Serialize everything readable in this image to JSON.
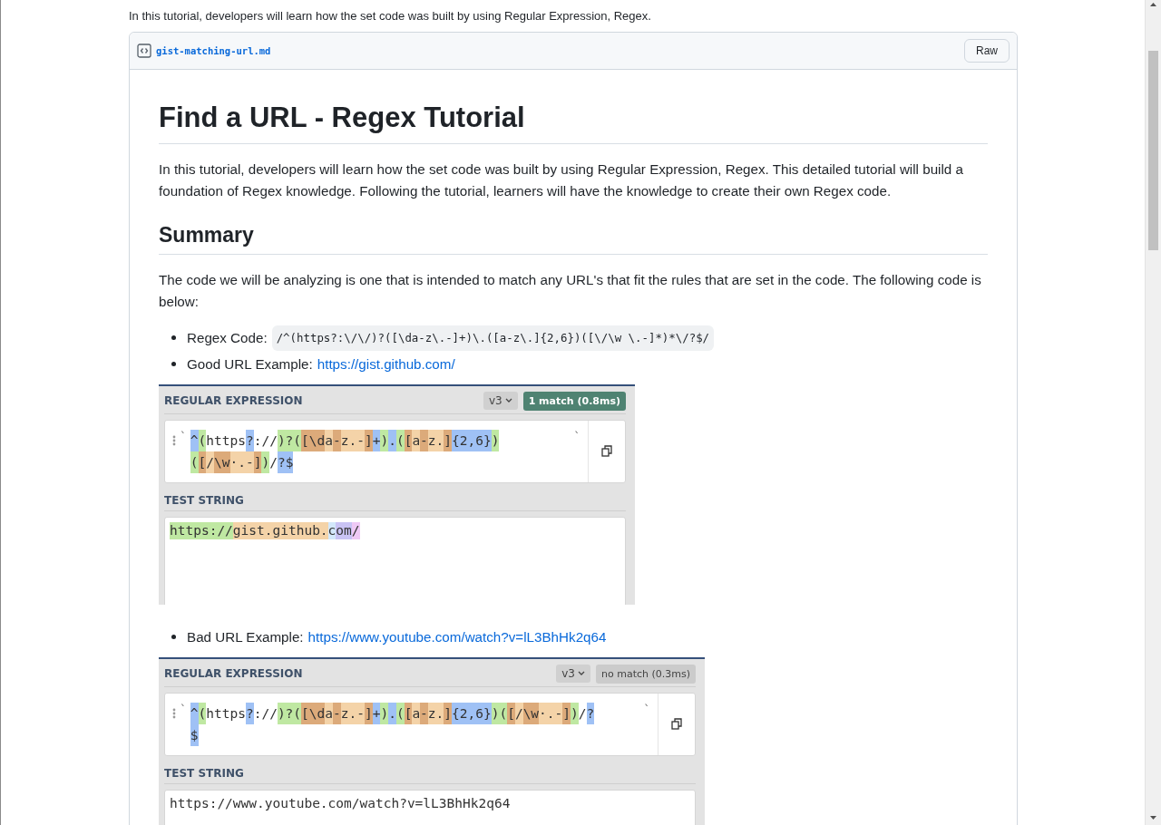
{
  "intro": "In this tutorial, developers will learn how the set code was built by using Regular Expression, Regex.",
  "gist": {
    "filename": "gist-matching-url.md",
    "raw_button": "Raw"
  },
  "article": {
    "title": "Find a URL - Regex Tutorial",
    "intro": "In this tutorial, developers will learn how the set code was built by using Regular Expression, Regex. This detailed tutorial will build a foundation of Regex knowledge. Following the tutorial, learners will have the knowledge to create their own Regex code.",
    "summary_heading": "Summary",
    "summary_text": "The code we will be analyzing is one that is intended to match any URL's that fit the rules that are set in the code. The following code is below:",
    "blocks": [
      {
        "kind": "bullet",
        "label": "Regex Code:",
        "code": "/^(https?:\\/\\/)?([\\da-z\\.-]+)\\.([a-z\\.]{2,6})([\\/\\w \\.-]*)*\\/?$/"
      },
      {
        "kind": "bullet",
        "label": "Good URL Example:",
        "link": "https://gist.github.com/"
      },
      {
        "kind": "regex_panel",
        "heading": "REGULAR EXPRESSION",
        "version": "v3",
        "result": "1 match (0.8ms)",
        "matched": true,
        "delimiter": "`",
        "test_heading": "TEST STRING",
        "lines": [
          [
            {
              "t": "^",
              "color": "#9fc1f5"
            },
            {
              "t": "(",
              "color": "#bfe8a2"
            },
            {
              "t": "https"
            },
            {
              "t": "?",
              "color": "#9fc1f5"
            },
            {
              "t": "://"
            },
            {
              "t": ")?(",
              "color": "#bfe8a2"
            },
            {
              "t": "[\\d",
              "color": "#dcaa7a"
            },
            {
              "t": "a",
              "color": "#f4d3a8"
            },
            {
              "t": "-",
              "color": "#dcaa7a"
            },
            {
              "t": "z.-",
              "color": "#f4d3a8"
            },
            {
              "t": "]",
              "color": "#dcaa7a"
            },
            {
              "t": "+",
              "color": "#9fc1f5"
            },
            {
              "t": ")",
              "color": "#bfe8a2"
            },
            {
              "t": ".",
              "color": "#9fc1f5"
            },
            {
              "t": "(",
              "color": "#bfe8a2"
            },
            {
              "t": "[",
              "color": "#dcaa7a"
            },
            {
              "t": "a",
              "color": "#f4d3a8"
            },
            {
              "t": "-",
              "color": "#dcaa7a"
            },
            {
              "t": "z.",
              "color": "#f4d3a8"
            },
            {
              "t": "]",
              "color": "#dcaa7a"
            },
            {
              "t": "{2,6}",
              "color": "#9fc1f5"
            },
            {
              "t": ")",
              "color": "#bfe8a2"
            }
          ],
          [
            {
              "t": "(",
              "color": "#bfe8a2"
            },
            {
              "t": "[",
              "color": "#dcaa7a"
            },
            {
              "t": "/",
              "color": "#f4d3a8"
            },
            {
              "t": "\\w",
              "color": "#dcaa7a"
            },
            {
              "t": "·.-",
              "color": "#f4d3a8"
            },
            {
              "t": "]",
              "color": "#dcaa7a"
            },
            {
              "t": ")",
              "color": "#bfe8a2"
            },
            {
              "t": "/"
            },
            {
              "t": "?$",
              "color": "#9fc1f5"
            }
          ]
        ],
        "test": [
          {
            "t": "https://",
            "color": "#bfe8a2"
          },
          {
            "t": "gist.github.",
            "color": "#f4d3a8"
          },
          {
            "t": "c",
            "color": "#d3e8fb"
          },
          {
            "t": "om",
            "color": "#c9c3f4"
          },
          {
            "t": "/",
            "color": "#efc9f5"
          }
        ]
      },
      {
        "kind": "bullet",
        "label": "Bad URL Example:",
        "link": "https://www.youtube.com/watch?v=lL3BhHk2q64"
      },
      {
        "kind": "regex_panel",
        "heading": "REGULAR EXPRESSION",
        "version": "v3",
        "result": "no match (0.3ms)",
        "matched": false,
        "delimiter": "`",
        "test_heading": "TEST STRING",
        "lines": [
          [
            {
              "t": "^",
              "color": "#9fc1f5"
            },
            {
              "t": "(",
              "color": "#bfe8a2"
            },
            {
              "t": "https"
            },
            {
              "t": "?",
              "color": "#9fc1f5"
            },
            {
              "t": "://"
            },
            {
              "t": ")?(",
              "color": "#bfe8a2"
            },
            {
              "t": "[\\d",
              "color": "#dcaa7a"
            },
            {
              "t": "a",
              "color": "#f4d3a8"
            },
            {
              "t": "-",
              "color": "#dcaa7a"
            },
            {
              "t": "z.-",
              "color": "#f4d3a8"
            },
            {
              "t": "]",
              "color": "#dcaa7a"
            },
            {
              "t": "+",
              "color": "#9fc1f5"
            },
            {
              "t": ")",
              "color": "#bfe8a2"
            },
            {
              "t": ".",
              "color": "#9fc1f5"
            },
            {
              "t": "(",
              "color": "#bfe8a2"
            },
            {
              "t": "[",
              "color": "#dcaa7a"
            },
            {
              "t": "a",
              "color": "#f4d3a8"
            },
            {
              "t": "-",
              "color": "#dcaa7a"
            },
            {
              "t": "z.",
              "color": "#f4d3a8"
            },
            {
              "t": "]",
              "color": "#dcaa7a"
            },
            {
              "t": "{2,6}",
              "color": "#9fc1f5"
            },
            {
              "t": ")(",
              "color": "#bfe8a2"
            },
            {
              "t": "[",
              "color": "#dcaa7a"
            },
            {
              "t": "/",
              "color": "#f4d3a8"
            },
            {
              "t": "\\w",
              "color": "#dcaa7a"
            },
            {
              "t": "·.-",
              "color": "#f4d3a8"
            },
            {
              "t": "]",
              "color": "#dcaa7a"
            },
            {
              "t": ")",
              "color": "#bfe8a2"
            },
            {
              "t": "/"
            },
            {
              "t": "?",
              "color": "#9fc1f5"
            }
          ],
          [
            {
              "t": "$",
              "color": "#9fc1f5"
            }
          ]
        ],
        "test": [
          {
            "t": "https://www.youtube.com/watch?v=lL3BhHk2q64"
          }
        ]
      }
    ]
  }
}
